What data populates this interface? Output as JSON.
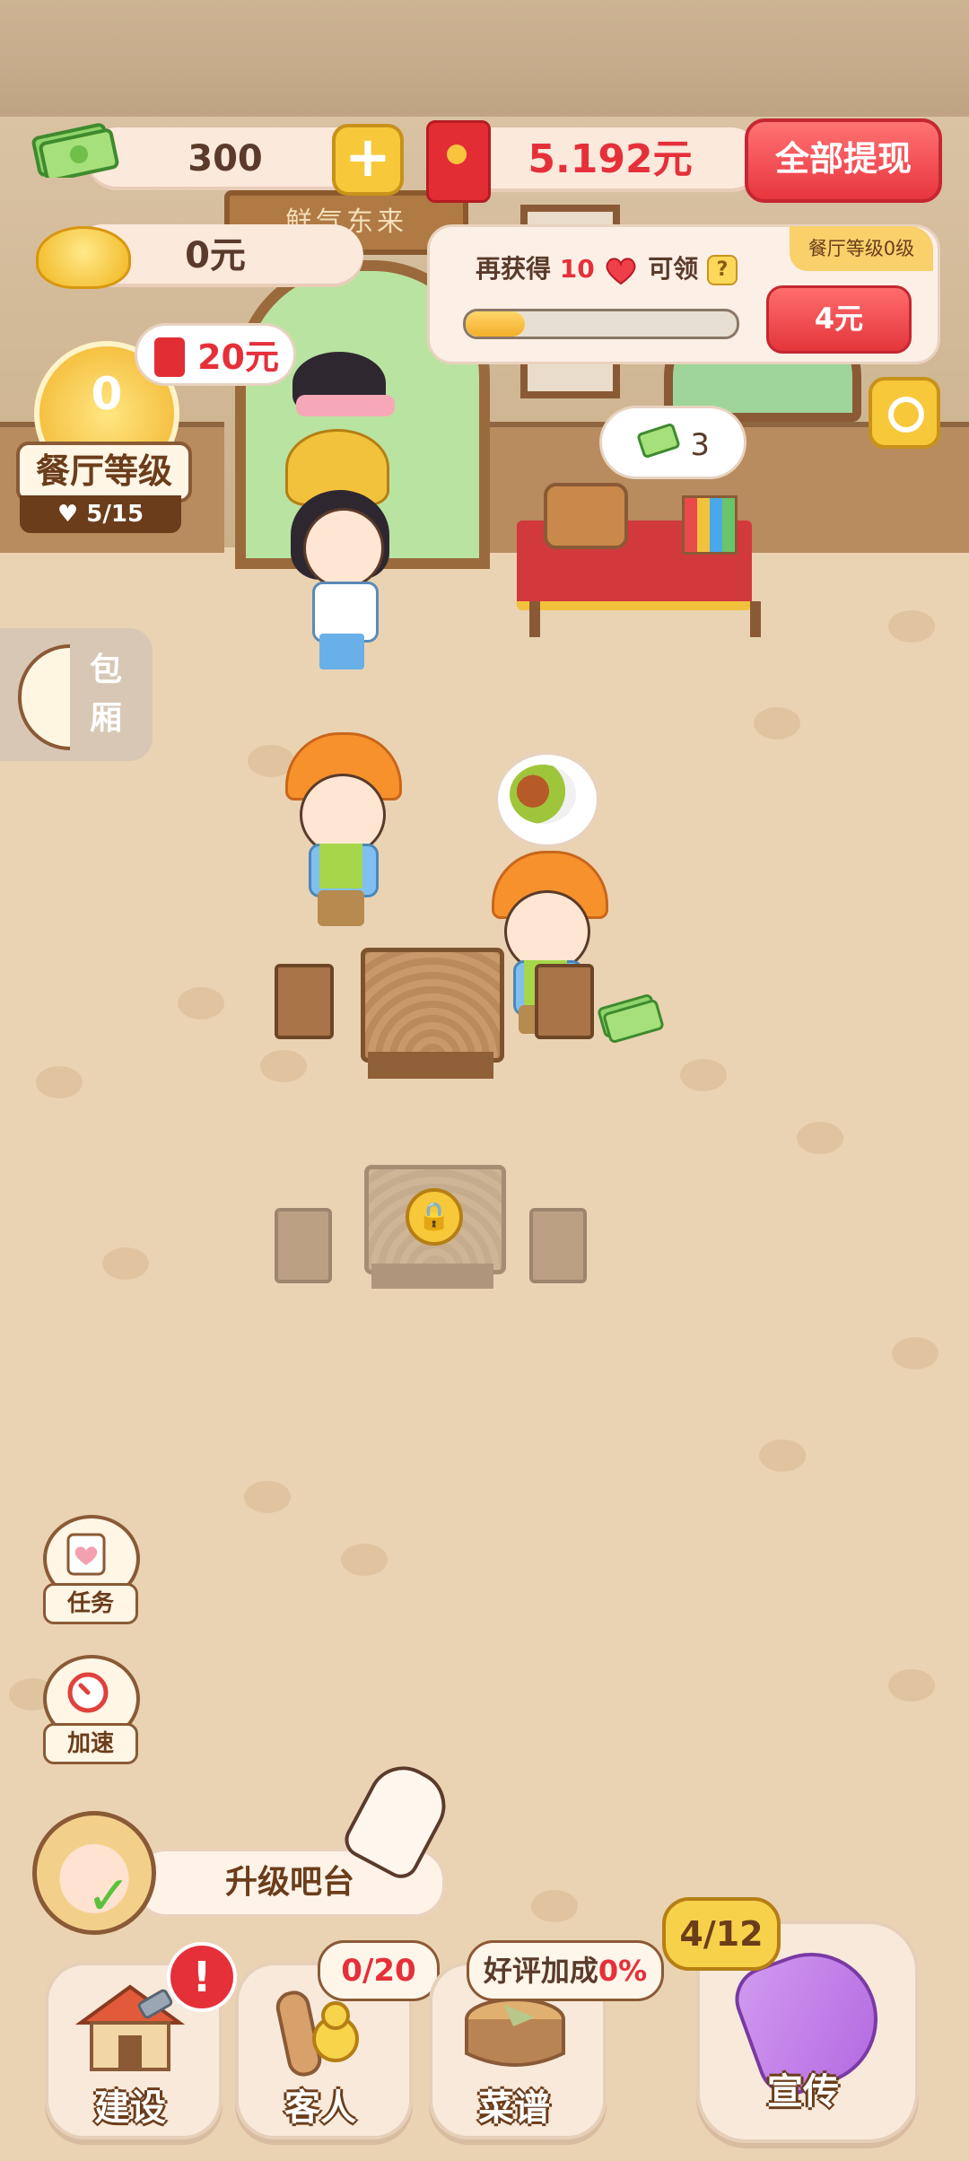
{
  "hud": {
    "cash": "300",
    "plus_label": "+",
    "gold": "0元",
    "red_envelope": "5.192元",
    "withdraw_all": "全部提现",
    "restaurant_level_tag": "餐厅等级0级",
    "task_prefix": "再获得",
    "task_count": "10",
    "task_suffix": "可领",
    "task_help": "?",
    "task_progress": 0.22,
    "task_reward": "4元"
  },
  "scene": {
    "shop_sign": "鲜气东来"
  },
  "restaurant_level": {
    "level": "0",
    "label": "餐厅等级",
    "hearts": "5/15",
    "reward": "20元"
  },
  "private_room": {
    "label_1": "包",
    "label_2": "厢"
  },
  "counter": {
    "cash_count": "3"
  },
  "tables": {
    "locked_icon": "lock-icon"
  },
  "side_buttons": {
    "tasks": "任务",
    "speed": "加速"
  },
  "prompt": {
    "upgrade": "升级吧台"
  },
  "bottom_nav": {
    "build": "建设",
    "alert": "!",
    "guests": "客人",
    "guests_count": "0/20",
    "menu": "菜谱",
    "rating_label": "好评加成",
    "rating_value": "0%",
    "promote": "宣传",
    "promote_count": "4/12"
  },
  "colors": {
    "accent_red": "#e5303a",
    "gold": "#f7c83a",
    "brown": "#6b3d1b",
    "floor": "#ead3b3"
  }
}
